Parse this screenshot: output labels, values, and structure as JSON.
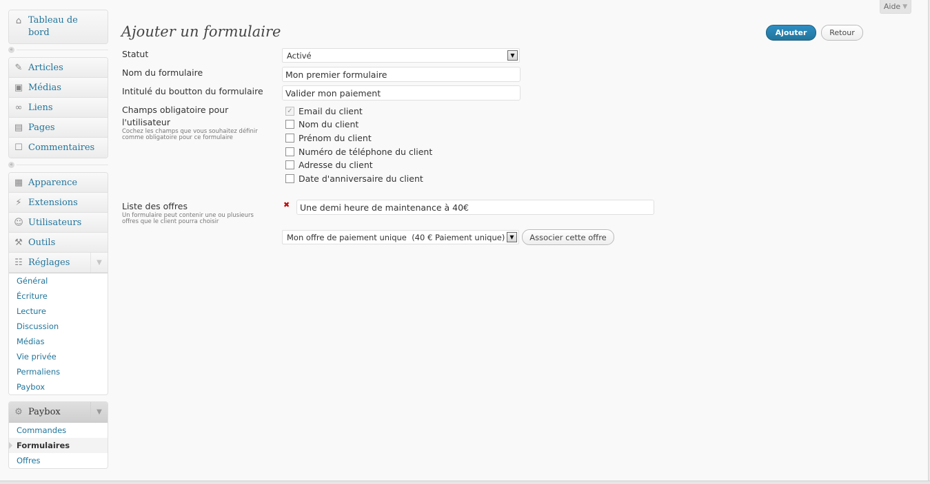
{
  "help_tab": {
    "label": "Aide"
  },
  "sidebar": {
    "dashboard": {
      "label": "Tableau de bord"
    },
    "group1": [
      {
        "label": "Articles",
        "icon": "pushpin-icon"
      },
      {
        "label": "Médias",
        "icon": "media-icon"
      },
      {
        "label": "Liens",
        "icon": "link-icon"
      },
      {
        "label": "Pages",
        "icon": "pages-icon"
      },
      {
        "label": "Commentaires",
        "icon": "comment-icon"
      }
    ],
    "group2": [
      {
        "label": "Apparence",
        "icon": "appearance-icon"
      },
      {
        "label": "Extensions",
        "icon": "plugin-icon"
      },
      {
        "label": "Utilisateurs",
        "icon": "users-icon"
      },
      {
        "label": "Outils",
        "icon": "tools-icon"
      }
    ],
    "settings": {
      "label": "Réglages",
      "items": [
        "Général",
        "Écriture",
        "Lecture",
        "Discussion",
        "Médias",
        "Vie privée",
        "Permaliens",
        "Paybox"
      ]
    },
    "paybox": {
      "label": "Paybox",
      "items": [
        "Commandes",
        "Formulaires",
        "Offres"
      ],
      "current": "Formulaires"
    }
  },
  "main": {
    "title": "Ajouter un formulaire",
    "add_button": "Ajouter",
    "back_button": "Retour",
    "status": {
      "label": "Statut",
      "value": "Activé"
    },
    "form_name": {
      "label": "Nom du formulaire",
      "value": "Mon premier formulaire"
    },
    "button_title": {
      "label": "Intitulé du boutton du formulaire",
      "value": "Valider mon paiement"
    },
    "required_fields": {
      "label_line1": "Champs obligatoire pour",
      "label_line2": "l'utilisateur",
      "desc_line1": "Cochez les champs que vous souhaitez définir",
      "desc_line2": "comme obligatoire pour ce formulaire",
      "options": [
        {
          "label": "Email du client",
          "checked": true,
          "disabled": true
        },
        {
          "label": "Nom du client",
          "checked": false
        },
        {
          "label": "Prénom du client",
          "checked": false
        },
        {
          "label": "Numéro de téléphone du client",
          "checked": false
        },
        {
          "label": "Adresse du client",
          "checked": false
        },
        {
          "label": "Date d'anniversaire du client",
          "checked": false
        }
      ]
    },
    "offers": {
      "label": "Liste des offres",
      "desc_line1": "Un formulaire peut contenir une ou plusieurs",
      "desc_line2": "offres que le client pourra choisir",
      "current_offer": "Une demi heure de maintenance à 40€",
      "remove_glyph": "✖",
      "select_value": "Mon offre de paiement unique  (40 € Paiement unique)",
      "associate_button": "Associer cette offre"
    }
  }
}
